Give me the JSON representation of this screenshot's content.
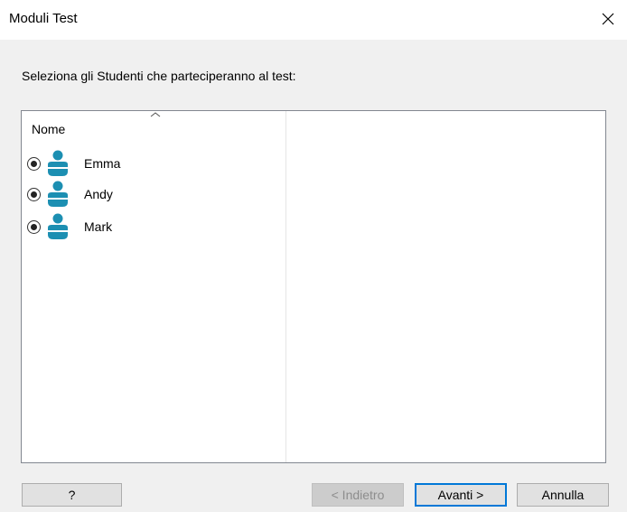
{
  "window": {
    "title": "Moduli Test",
    "close_icon": "close-icon"
  },
  "instruction": "Seleziona gli Studenti che parteciperanno al test:",
  "list": {
    "column_header": "Nome",
    "sort_icon": "sort-ascending-icon",
    "students": [
      {
        "name": "Emma",
        "selected": true
      },
      {
        "name": "Andy",
        "selected": true
      },
      {
        "name": "Mark",
        "selected": true
      }
    ],
    "icon_color": "#1c8fb2"
  },
  "buttons": {
    "help": "?",
    "back": "< Indietro",
    "next": "Avanti >",
    "cancel": "Annulla"
  },
  "colors": {
    "accent": "#0078d7"
  }
}
